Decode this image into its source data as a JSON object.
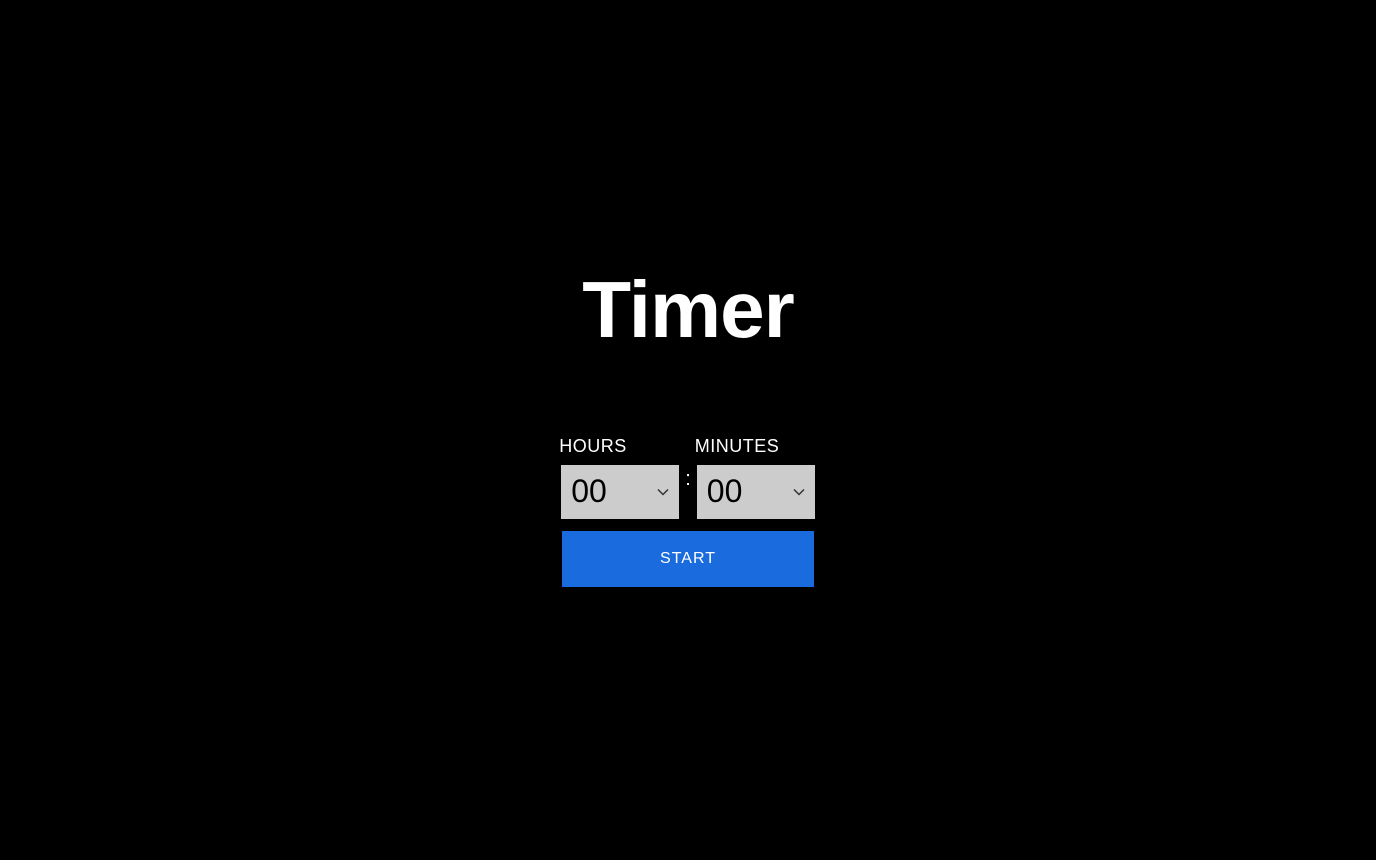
{
  "title": "Timer",
  "hours": {
    "label": "HOURS",
    "value": "00"
  },
  "minutes": {
    "label": "MINUTES",
    "value": "00"
  },
  "separator": ":",
  "start_label": "START",
  "colors": {
    "accent": "#1a6bdd",
    "background": "#000000",
    "select_bg": "#cccccc"
  }
}
